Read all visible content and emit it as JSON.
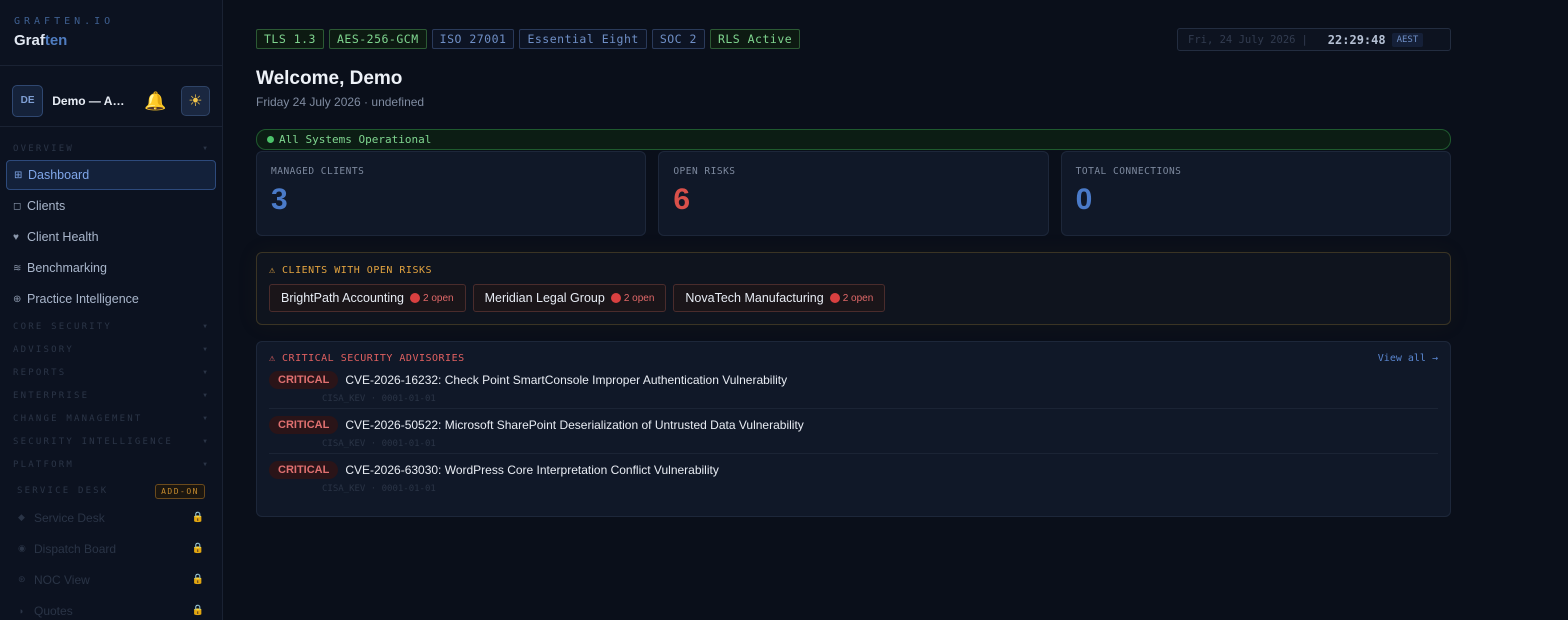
{
  "brand": {
    "kicker": "GRAFTEN.IO",
    "name_main": "Graf",
    "name_accent": "ten"
  },
  "account": {
    "initials": "DE",
    "name": "Demo — Ac...",
    "bell_icon": "bell-icon",
    "theme_icon": "sun-icon"
  },
  "sidebar": {
    "overview_label": "OVERVIEW",
    "items": [
      {
        "label": "Dashboard",
        "icon": "⊞"
      },
      {
        "label": "Clients",
        "icon": "◻"
      },
      {
        "label": "Client Health",
        "icon": "♥"
      },
      {
        "label": "Benchmarking",
        "icon": "≋"
      },
      {
        "label": "Practice Intelligence",
        "icon": "⊕"
      }
    ],
    "sections": [
      "CORE SECURITY",
      "ADVISORY",
      "REPORTS",
      "ENTERPRISE",
      "CHANGE MANAGEMENT",
      "SECURITY INTELLIGENCE",
      "PLATFORM"
    ],
    "service_desk": {
      "label": "SERVICE DESK",
      "badge": "ADD-ON"
    },
    "locked_items": [
      {
        "label": "Service Desk",
        "icon": "◆"
      },
      {
        "label": "Dispatch Board",
        "icon": "◉"
      },
      {
        "label": "NOC View",
        "icon": "⊛"
      },
      {
        "label": "Quotes",
        "icon": "◑"
      }
    ]
  },
  "tags": [
    {
      "label": "TLS 1.3",
      "color": "green"
    },
    {
      "label": "AES-256-GCM",
      "color": "green"
    },
    {
      "label": "ISO 27001",
      "color": "blue"
    },
    {
      "label": "Essential Eight",
      "color": "blue"
    },
    {
      "label": "SOC 2",
      "color": "blue"
    },
    {
      "label": "RLS Active",
      "color": "green"
    }
  ],
  "clock": {
    "date": "Fri, 24 July 2026",
    "sep": "|",
    "time": "22:29:48",
    "tz": "AEST"
  },
  "welcome": "Welcome, Demo",
  "subdate": "Friday 24 July 2026 · undefined",
  "status": "All Systems Operational",
  "stats": [
    {
      "label": "MANAGED CLIENTS",
      "value": "3",
      "color": "#4a7ac8"
    },
    {
      "label": "OPEN RISKS",
      "value": "6",
      "color": "#d9504a"
    },
    {
      "label": "TOTAL CONNECTIONS",
      "value": "0",
      "color": "#4a7ac8"
    }
  ],
  "risks": {
    "title": "⚠ CLIENTS WITH OPEN RISKS",
    "title_color": "#e2a340",
    "clients": [
      {
        "name": "BrightPath Accounting",
        "count": "2 open"
      },
      {
        "name": "Meridian Legal Group",
        "count": "2 open"
      },
      {
        "name": "NovaTech Manufacturing",
        "count": "2 open"
      }
    ]
  },
  "advisories": {
    "title": "⚠ CRITICAL SECURITY ADVISORIES",
    "title_color": "#e06060",
    "view_all": "View all →",
    "items": [
      {
        "severity": "CRITICAL",
        "title": "CVE-2026-16232: Check Point SmartConsole Improper Authentication Vulnerability",
        "meta": "CISA_KEV · 0001-01-01"
      },
      {
        "severity": "CRITICAL",
        "title": "CVE-2026-50522: Microsoft SharePoint Deserialization of Untrusted Data Vulnerability",
        "meta": "CISA_KEV · 0001-01-01"
      },
      {
        "severity": "CRITICAL",
        "title": "CVE-2026-63030: WordPress Core Interpretation Conflict Vulnerability",
        "meta": "CISA_KEV · 0001-01-01"
      }
    ]
  }
}
